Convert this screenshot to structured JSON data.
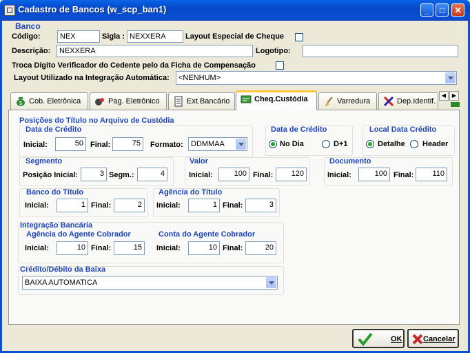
{
  "window": {
    "title": "Cadastro de Bancos (w_scp_ban1)"
  },
  "banco": {
    "group": "Banco",
    "codigo_label": "Código:",
    "codigo": "NEX",
    "sigla_label": "Sigla :",
    "sigla": "NEXXERA",
    "layout_especial_label": "Layout Especial de Cheque",
    "descricao_label": "Descrição:",
    "descricao": "NEXXERA",
    "logotipo_label": "Logotipo:",
    "logotipo": "",
    "troca_digito_label": "Troca Dígito Verificador do Cedente pelo da Ficha de Compensação",
    "layout_utilizado_label": "Layout Utilizado na Integração Automática:",
    "layout_utilizado": "<NENHUM>"
  },
  "tabs": [
    {
      "label": "Cob. Eletrônica",
      "icon": "money-bag-icon"
    },
    {
      "label": "Pag. Eletrônico",
      "icon": "payment-icon"
    },
    {
      "label": "Ext.Bancário",
      "icon": "document-icon"
    },
    {
      "label": "Cheq.Custódia",
      "icon": "cheque-icon"
    },
    {
      "label": "Varredura",
      "icon": "broom-icon"
    },
    {
      "label": "Dep.Identif.",
      "icon": "deposit-icon"
    }
  ],
  "custodia": {
    "section_title": "Posições do Título no Arquivo de Custódia",
    "data_credito": {
      "title": "Data de Crédito",
      "inicial_label": "Inicial:",
      "inicial": "50",
      "final_label": "Final:",
      "final": "75",
      "formato_label": "Formato:",
      "formato": "DDMMAA"
    },
    "data_credito_opcao": {
      "title": "Data de Crédito",
      "opt1": "No Dia",
      "opt2": "D+1"
    },
    "local_data_credito": {
      "title": "Local Data Crédito",
      "opt1": "Detalhe",
      "opt2": "Header"
    },
    "segmento": {
      "title": "Segmento",
      "posicao_label": "Posição Inicial:",
      "posicao": "3",
      "segm_label": "Segm.:",
      "segm": "4"
    },
    "valor": {
      "title": "Valor",
      "inicial_label": "Inicial:",
      "inicial": "100",
      "final_label": "Final:",
      "final": "120"
    },
    "documento": {
      "title": "Documento",
      "inicial_label": "Inicial:",
      "inicial": "100",
      "final_label": "Final:",
      "final": "110"
    },
    "banco_titulo": {
      "title": "Banco do Título",
      "inicial_label": "Inicial:",
      "inicial": "1",
      "final_label": "Final:",
      "final": "2"
    },
    "agencia_titulo": {
      "title": "Agência do Título",
      "inicial_label": "Inicial:",
      "inicial": "1",
      "final_label": "Final:",
      "final": "3"
    },
    "integracao_title": "Integração Bancária",
    "agencia_agente": {
      "title": "Agência do Agente Cobrador",
      "inicial_label": "Inicial:",
      "inicial": "10",
      "final_label": "Final:",
      "final": "15"
    },
    "conta_agente": {
      "title": "Conta do Agente Cobrador",
      "inicial_label": "Inicial:",
      "inicial": "10",
      "final_label": "Final:",
      "final": "20"
    },
    "credito_debito": {
      "title": "Crédito/Débito da Baixa",
      "value": "BAIXA AUTOMATICA"
    }
  },
  "buttons": {
    "ok": "OK",
    "cancelar": "Cancelar"
  }
}
